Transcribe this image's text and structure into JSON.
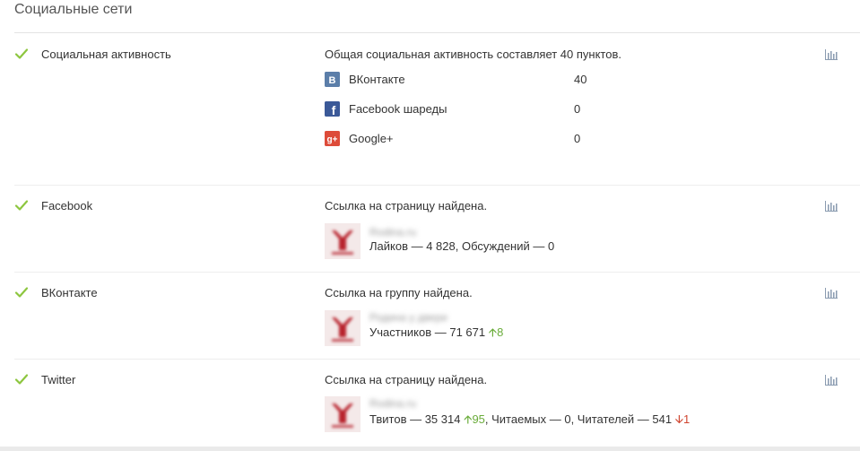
{
  "section": {
    "title": "Социальные сети"
  },
  "colors": {
    "check": "#8dc63f",
    "up": "#6aac3a",
    "down": "#d0452f",
    "vk": "#5b7ea9",
    "facebook": "#3b5998",
    "gplus": "#dd4b39"
  },
  "rows": {
    "social_activity": {
      "label": "Социальная активность",
      "description": "Общая социальная активность составляет 40 пунктов.",
      "networks": [
        {
          "icon": "vk-icon",
          "name": "ВКонтакте",
          "value": "40"
        },
        {
          "icon": "facebook-icon",
          "name": "Facebook шареды",
          "value": "0"
        },
        {
          "icon": "google-plus-icon",
          "name": "Google+",
          "value": "0"
        }
      ]
    },
    "facebook": {
      "label": "Facebook",
      "description": "Ссылка на страницу найдена.",
      "page_name": "Rodina.ru",
      "stats": {
        "likes": "Лайков — 4 828",
        "sep": ", ",
        "discussions": "Обсуждений — 0"
      }
    },
    "vkontakte": {
      "label": "ВКонтакте",
      "description": "Ссылка на группу найдена.",
      "page_name": "Родина у двери",
      "stats": {
        "members": "Участников — 71 671",
        "members_delta": "8"
      }
    },
    "twitter": {
      "label": "Twitter",
      "description": "Ссылка на страницу найдена.",
      "page_name": "Rodina.ru",
      "stats": {
        "tweets": "Твитов — 35 314",
        "tweets_delta": "95",
        "reads": ", Читаемых — 0",
        "readers": ", Читателей — 541",
        "readers_delta": "1"
      }
    }
  }
}
